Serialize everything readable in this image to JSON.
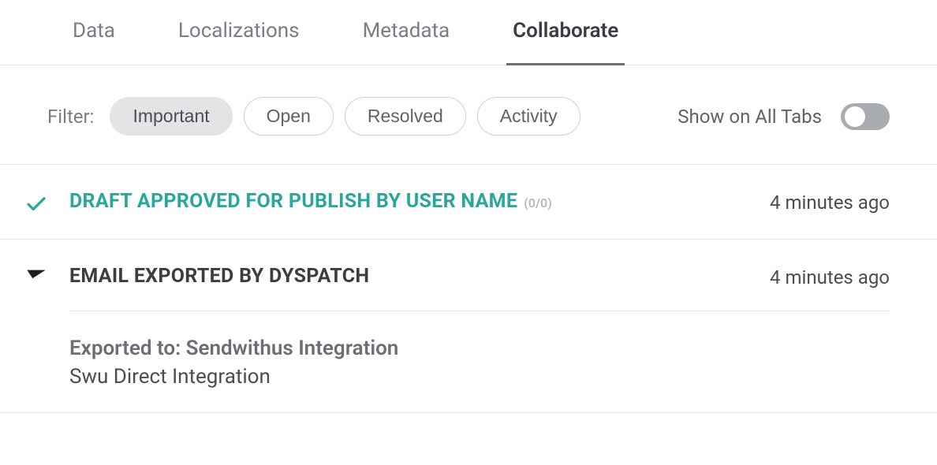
{
  "tabs": {
    "items": [
      {
        "label": "Data"
      },
      {
        "label": "Localizations"
      },
      {
        "label": "Metadata"
      },
      {
        "label": "Collaborate"
      }
    ],
    "activeIndex": 3
  },
  "filter": {
    "label": "Filter:",
    "chips": [
      {
        "label": "Important"
      },
      {
        "label": "Open"
      },
      {
        "label": "Resolved"
      },
      {
        "label": "Activity"
      }
    ],
    "activeIndex": 0,
    "toggle": {
      "label": "Show on All Tabs",
      "on": false
    }
  },
  "activity": {
    "items": [
      {
        "icon": "check-icon",
        "title": "DRAFT APPROVED FOR PUBLISH BY USER NAME",
        "status": "approved",
        "count": "(0/0)",
        "time": "4 minutes ago"
      },
      {
        "icon": "send-icon",
        "title": "EMAIL EXPORTED BY DYSPATCH",
        "status": "neutral",
        "time": "4 minutes ago",
        "detail": {
          "label": "Exported to: Sendwithus Integration",
          "text": "Swu Direct Integration"
        }
      }
    ]
  },
  "colors": {
    "accent": "#2aa79b"
  }
}
